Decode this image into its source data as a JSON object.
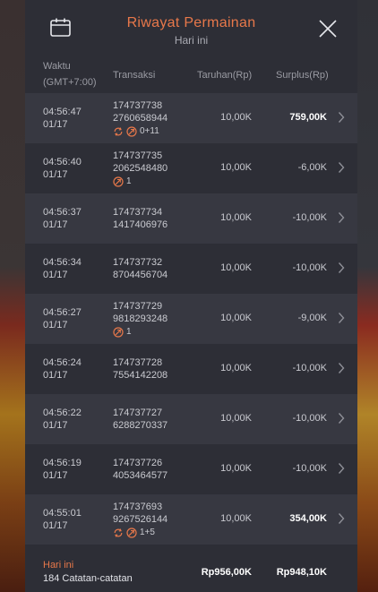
{
  "header": {
    "title": "Riwayat Permainan",
    "subtitle": "Hari ini",
    "calendar_icon": "calendar-icon",
    "close_icon": "close-icon"
  },
  "columns": {
    "time_line1": "Waktu",
    "time_line2": "(GMT+7:00)",
    "transaction": "Transaksi",
    "bet": "Taruhan(Rp)",
    "surplus": "Surplus(Rp)"
  },
  "rows": [
    {
      "time": "04:56:47",
      "date": "01/17",
      "tx1": "174737738",
      "tx2": "2760658944",
      "free_spin": true,
      "bonus": true,
      "badge_text": "0+11",
      "bet": "10,00K",
      "surplus": "759,00K",
      "positive": true
    },
    {
      "time": "04:56:40",
      "date": "01/17",
      "tx1": "174737735",
      "tx2": "2062548480",
      "free_spin": false,
      "bonus": true,
      "badge_text": "1",
      "bet": "10,00K",
      "surplus": "-6,00K",
      "positive": false
    },
    {
      "time": "04:56:37",
      "date": "01/17",
      "tx1": "174737734",
      "tx2": "1417406976",
      "free_spin": false,
      "bonus": false,
      "badge_text": "",
      "bet": "10,00K",
      "surplus": "-10,00K",
      "positive": false
    },
    {
      "time": "04:56:34",
      "date": "01/17",
      "tx1": "174737732",
      "tx2": "8704456704",
      "free_spin": false,
      "bonus": false,
      "badge_text": "",
      "bet": "10,00K",
      "surplus": "-10,00K",
      "positive": false
    },
    {
      "time": "04:56:27",
      "date": "01/17",
      "tx1": "174737729",
      "tx2": "9818293248",
      "free_spin": false,
      "bonus": true,
      "badge_text": "1",
      "bet": "10,00K",
      "surplus": "-9,00K",
      "positive": false
    },
    {
      "time": "04:56:24",
      "date": "01/17",
      "tx1": "174737728",
      "tx2": "7554142208",
      "free_spin": false,
      "bonus": false,
      "badge_text": "",
      "bet": "10,00K",
      "surplus": "-10,00K",
      "positive": false
    },
    {
      "time": "04:56:22",
      "date": "01/17",
      "tx1": "174737727",
      "tx2": "6288270337",
      "free_spin": false,
      "bonus": false,
      "badge_text": "",
      "bet": "10,00K",
      "surplus": "-10,00K",
      "positive": false
    },
    {
      "time": "04:56:19",
      "date": "01/17",
      "tx1": "174737726",
      "tx2": "4053464577",
      "free_spin": false,
      "bonus": false,
      "badge_text": "",
      "bet": "10,00K",
      "surplus": "-10,00K",
      "positive": false
    },
    {
      "time": "04:55:01",
      "date": "01/17",
      "tx1": "174737693",
      "tx2": "9267526144",
      "free_spin": true,
      "bonus": true,
      "badge_text": "1+5",
      "bet": "10,00K",
      "surplus": "354,00K",
      "positive": true
    }
  ],
  "footer": {
    "label": "Hari ini",
    "count": "184 Catatan-catatan",
    "total_bet": "Rp956,00K",
    "total_surplus": "Rp948,10K"
  },
  "colors": {
    "accent": "#e8784a",
    "panel": "#2d2e36",
    "row_alt": "#373841"
  }
}
